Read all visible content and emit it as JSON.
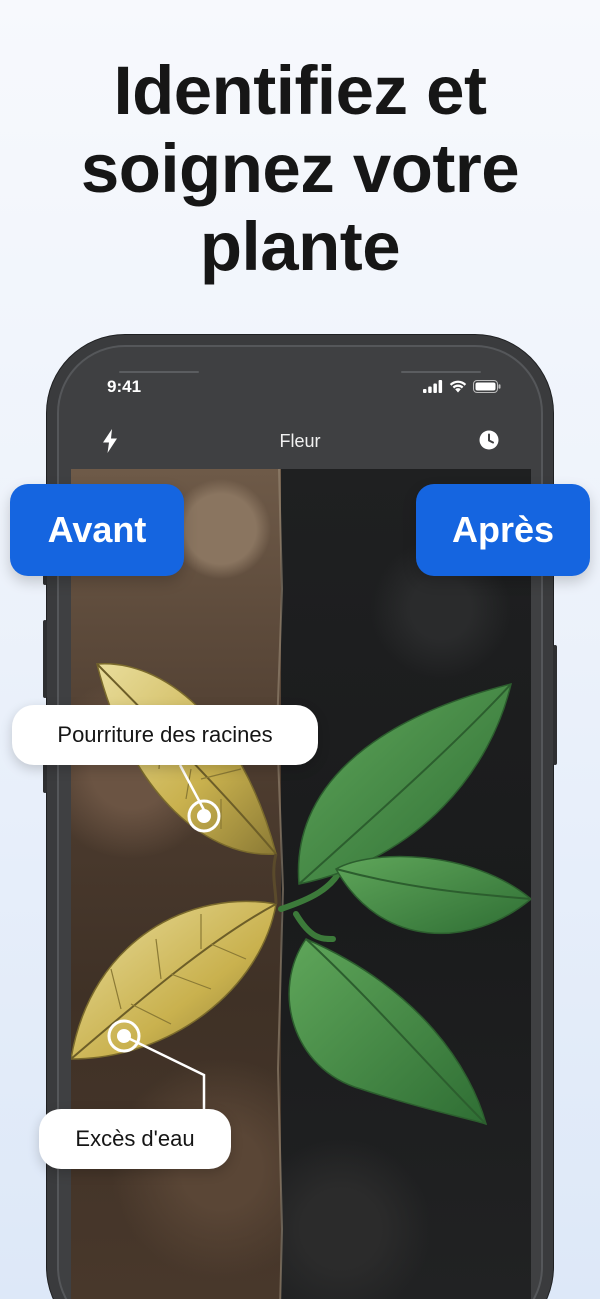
{
  "headline": {
    "line1": "Identifiez et",
    "line2": "soignez votre",
    "line3": "plante"
  },
  "statusbar": {
    "time": "9:41"
  },
  "navbar": {
    "title": "Fleur",
    "left_icon": "flash-icon",
    "right_icon": "history-clock-icon"
  },
  "labels": {
    "before": "Avant",
    "after": "Après"
  },
  "diagnosis_tags": {
    "root_rot": "Pourriture des racines",
    "overwatering": "Excès d'eau"
  },
  "colors": {
    "accent": "#1565e0",
    "headline_text": "#161616",
    "phone_frame": "#3a3b3d"
  }
}
